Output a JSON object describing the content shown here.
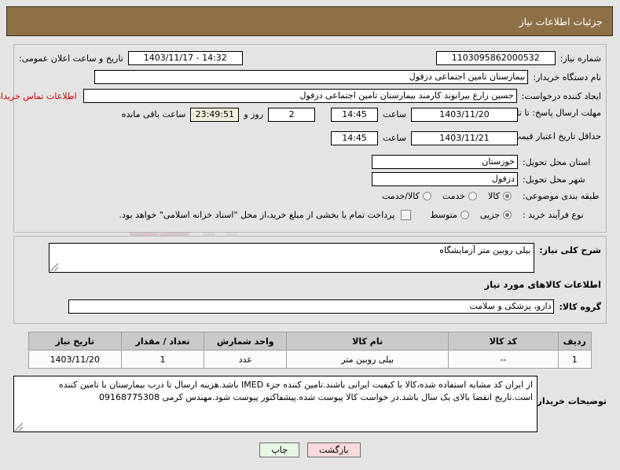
{
  "header": {
    "title": "جزئیات اطلاعات نیاز"
  },
  "form": {
    "need_number_label": "شماره نیاز:",
    "need_number_value": "1103095862000532",
    "public_announce_label": "تاریخ و ساعت اعلان عمومی:",
    "public_announce_value": "14:32 - 1403/11/17",
    "buyer_org_label": "نام دستگاه خریدار:",
    "buyer_org_value": "بیمارستان تامین اجتماعی دزفول",
    "requester_label": "ایجاد کننده درخواست:",
    "requester_value": "حسین زارع بیرانوند کارمند بیمارستان تامین اجتماعی دزفول",
    "buyer_contact_link": "اطلاعات تماس خریدار",
    "deadline_label": "مهلت ارسال پاسخ: تا تاریخ:",
    "deadline_date": "1403/11/20",
    "hour_label": "ساعت",
    "deadline_time": "14:45",
    "remaining_days": "2",
    "days_and_label": "روز و",
    "remaining_time": "23:49:51",
    "remaining_suffix": "ساعت باقی مانده",
    "price_validity_label": "حداقل تاریخ اعتبار قیمت: تا تاریخ:",
    "price_validity_date": "1403/11/21",
    "price_validity_time": "14:45",
    "province_label": "استان محل تحویل:",
    "province_value": "خوزستان",
    "city_label": "شهر محل تحویل:",
    "city_value": "دزفول",
    "classification_label": "طبقه بندی موضوعی:",
    "classification_options": [
      {
        "label": "کالا",
        "selected": true
      },
      {
        "label": "خدمت",
        "selected": false
      },
      {
        "label": "کالا/خدمت",
        "selected": false
      }
    ],
    "process_type_label": "نوع فرآیند خرید :",
    "process_type_options": [
      {
        "label": "جزیی",
        "selected": true
      },
      {
        "label": "متوسط",
        "selected": false
      }
    ],
    "treasury_checkbox_label": "پرداخت تمام یا بخشی از مبلغ خرید،از محل \"اسناد خزانه اسلامی\" خواهد بود.",
    "treasury_checked": false
  },
  "description": {
    "label": "شرح کلی نیاز:",
    "value": "بیلی روبین متر آزمایشگاه"
  },
  "goods_section": {
    "title": "اطلاعات کالاهای مورد نیاز",
    "group_label": "گروه کالا:",
    "group_value": "دارو، پزشکی و سلامت"
  },
  "items_table": {
    "columns": [
      "ردیف",
      "کد کالا",
      "نام کالا",
      "واحد شمارش",
      "تعداد / مقدار",
      "تاریخ نیاز"
    ],
    "rows": [
      [
        "1",
        "--",
        "بیلی روبین متر",
        "عدد",
        "1",
        "1403/11/20"
      ]
    ]
  },
  "notes": {
    "label": "توضیحات خریدار:",
    "value": "از ایران کد مشابه استفاده شده،کالا با کیفیت ایرانی باشند.تامین کننده جزء IMED باشد.هزینه ارسال تا درب بیمارستان با تامین کننده است.تاریخ انقضا بالای یک سال باشد.در خواست کالا پیوست شده.پیشفاکتور پیوست شود.مهندس کرمی 09168775308"
  },
  "buttons": {
    "print": "چاپ",
    "back": "بازگشت"
  },
  "colors": {
    "header_bg": "#8d7046",
    "page_bg": "#e4e4e4",
    "link_red": "#d40000",
    "print_btn_bg": "#e8f6e4",
    "back_btn_bg": "#fbd9dc",
    "beige_field": "#f2efdd"
  },
  "watermark": {
    "text": "AriaTender.net"
  }
}
